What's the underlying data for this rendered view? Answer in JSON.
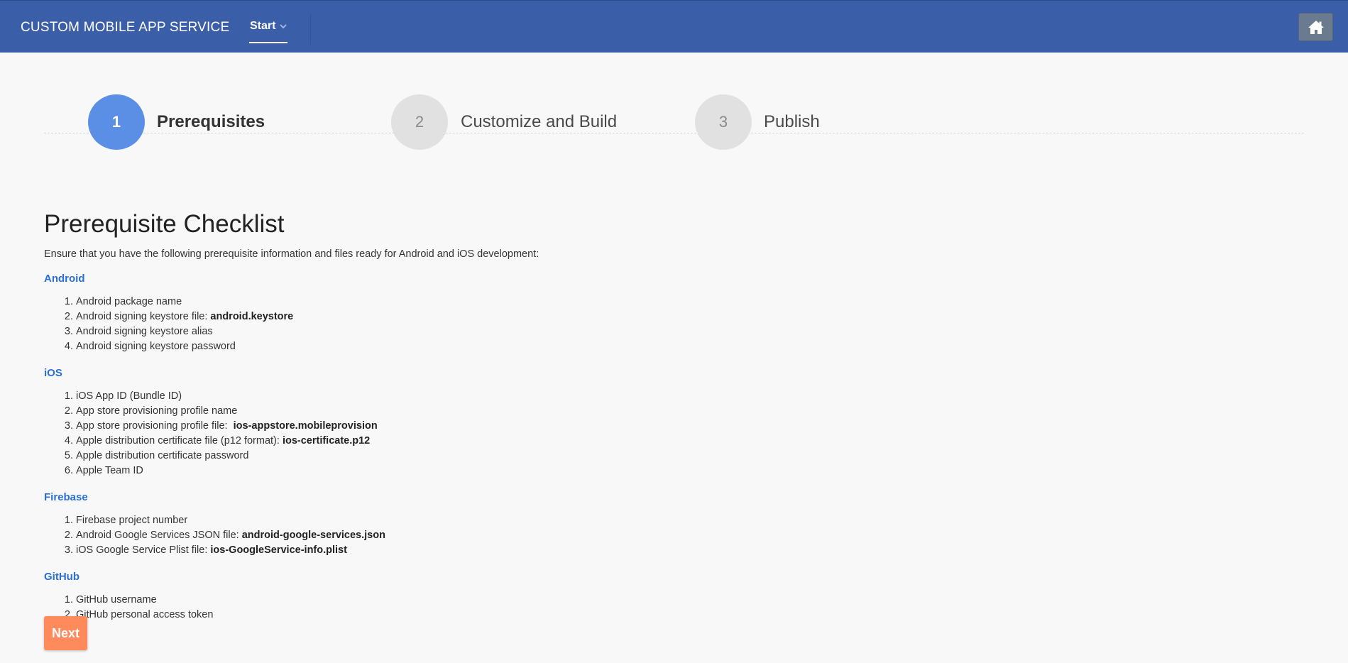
{
  "header": {
    "brand": "CUSTOM MOBILE APP SERVICE",
    "nav": {
      "start_label": "Start"
    },
    "home_icon": "home-icon"
  },
  "steps": [
    {
      "number": "1",
      "label": "Prerequisites",
      "state": "active"
    },
    {
      "number": "2",
      "label": "Customize and Build",
      "state": "inactive"
    },
    {
      "number": "3",
      "label": "Publish",
      "state": "inactive"
    }
  ],
  "checklist": {
    "title": "Prerequisite Checklist",
    "intro": "Ensure that you have the following prerequisite information and files ready for Android and iOS development:",
    "sections": [
      {
        "title": "Android",
        "items": [
          {
            "text": "Android package name",
            "bold": ""
          },
          {
            "text": "Android signing keystore file: ",
            "bold": "android.keystore"
          },
          {
            "text": "Android signing keystore alias",
            "bold": ""
          },
          {
            "text": "Android signing keystore password",
            "bold": ""
          }
        ]
      },
      {
        "title": "iOS",
        "items": [
          {
            "text": "iOS App ID (Bundle ID)",
            "bold": ""
          },
          {
            "text": "App store provisioning profile name",
            "bold": ""
          },
          {
            "text": "App store provisioning profile file:  ",
            "bold": "ios-appstore.mobileprovision"
          },
          {
            "text": "Apple distribution certificate file (p12 format): ",
            "bold": "ios-certificate.p12"
          },
          {
            "text": "Apple distribution certificate password",
            "bold": ""
          },
          {
            "text": "Apple Team ID",
            "bold": ""
          }
        ]
      },
      {
        "title": "Firebase",
        "items": [
          {
            "text": "Firebase project number",
            "bold": ""
          },
          {
            "text": "Android Google Services JSON file: ",
            "bold": "android-google-services.json"
          },
          {
            "text": "iOS Google Service Plist file: ",
            "bold": "ios-GoogleService-info.plist"
          }
        ]
      },
      {
        "title": "GitHub",
        "items": [
          {
            "text": "GitHub username",
            "bold": ""
          },
          {
            "text": "GitHub personal access token",
            "bold": ""
          }
        ]
      }
    ]
  },
  "actions": {
    "next_label": "Next"
  },
  "colors": {
    "header_bg": "#3b5ea8",
    "active_step": "#5b8fe6",
    "inactive_step": "#e1e1e1",
    "section_title": "#2a6fd6",
    "next_button": "#ff8a5c"
  }
}
